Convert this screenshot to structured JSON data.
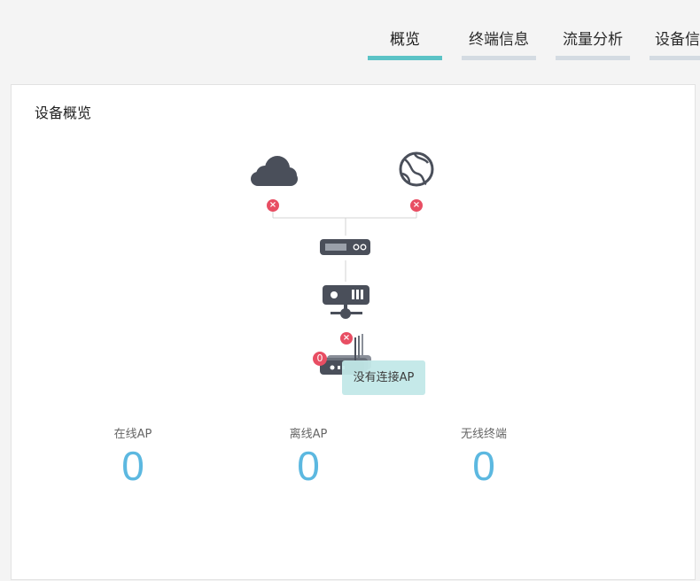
{
  "tabs": [
    {
      "label": "概览",
      "active": true
    },
    {
      "label": "终端信息",
      "active": false
    },
    {
      "label": "流量分析",
      "active": false
    },
    {
      "label": "设备信",
      "active": false
    }
  ],
  "panel": {
    "title": "设备概览"
  },
  "topology": {
    "nodes": [
      "cloud-icon",
      "globe-icon",
      "gateway-icon",
      "server-icon",
      "access-point-icon"
    ],
    "ap_count": "0",
    "tooltip": "没有连接AP"
  },
  "stats": [
    {
      "label": "在线AP",
      "value": "0"
    },
    {
      "label": "离线AP",
      "value": "0"
    },
    {
      "label": "无线终端",
      "value": "0"
    }
  ],
  "colors": {
    "accent": "#5bc3c6",
    "tab_inactive": "#d4dbe2",
    "error": "#e84e63",
    "icon": "#4a4f5a",
    "stat_value": "#5cb8e0",
    "tooltip_bg": "#c2e8e8"
  }
}
